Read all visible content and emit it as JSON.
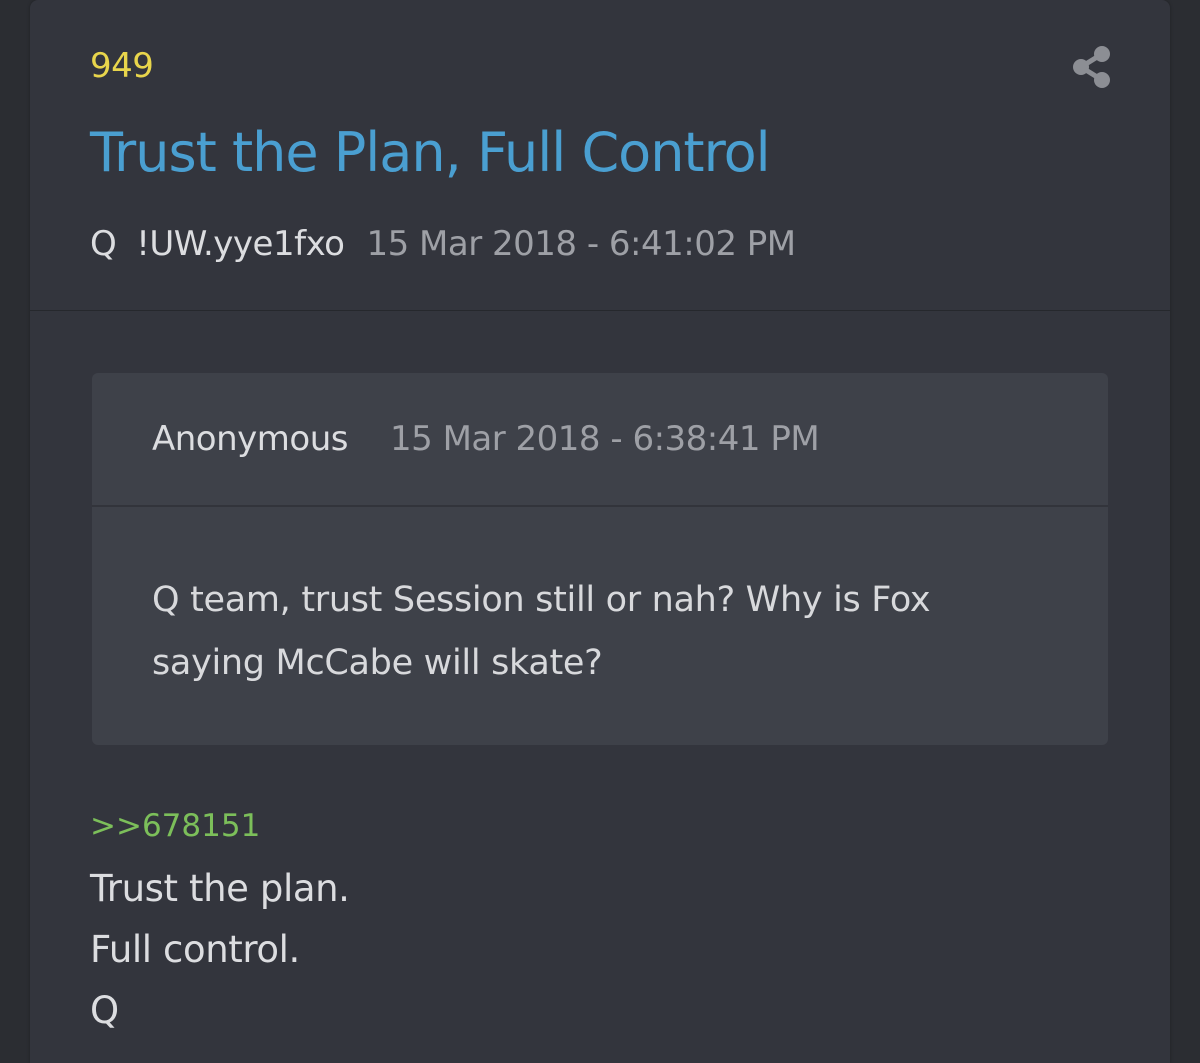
{
  "post": {
    "number": "949",
    "title": "Trust the Plan, Full Control",
    "author": "Q",
    "tripcode": "!UW.yye1fxo",
    "timestamp": "15 Mar 2018 - 6:41:02 PM",
    "share_icon": "share-icon"
  },
  "quoted": {
    "author": "Anonymous",
    "timestamp": "15 Mar 2018 - 6:38:41 PM",
    "lines": [
      "Q team, trust Session still or nah? Why is Fox",
      "saying McCabe will skate?"
    ]
  },
  "reply": {
    "link": ">>678151",
    "lines": [
      "Trust the plan.",
      "Full control.",
      "Q"
    ]
  },
  "colors": {
    "number": "#e8d54c",
    "title": "#4a9fd1",
    "link": "#7cbf5a",
    "card_bg": "#33353d",
    "quote_bg": "#3e4149"
  }
}
